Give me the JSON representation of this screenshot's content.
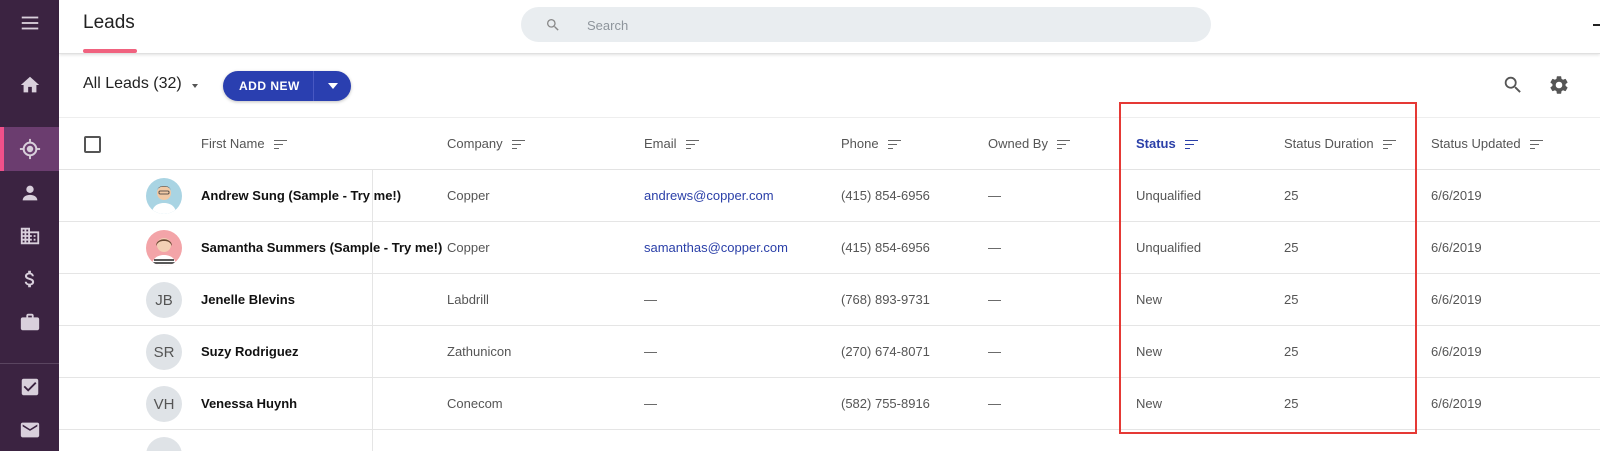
{
  "header": {
    "title": "Leads",
    "search_placeholder": "Search"
  },
  "sidebar": {
    "items": [
      {
        "icon": "menu-icon"
      },
      {
        "icon": "home-icon"
      },
      {
        "icon": "leads-target-icon",
        "active": true
      },
      {
        "icon": "person-icon"
      },
      {
        "icon": "company-building-icon"
      },
      {
        "icon": "dollar-icon"
      },
      {
        "icon": "briefcase-icon"
      },
      {
        "icon": "task-check-icon"
      },
      {
        "icon": "mail-icon"
      }
    ]
  },
  "toolbar": {
    "view_label": "All Leads (32)",
    "add_new_label": "ADD NEW"
  },
  "table": {
    "columns": [
      "First Name",
      "Company",
      "Email",
      "Phone",
      "Owned By",
      "Status",
      "Status Duration",
      "Status Updated"
    ],
    "sorted_column": "Status",
    "rows": [
      {
        "avatar": "",
        "avatar_type": "photo1",
        "name": "Andrew Sung (Sample - Try me!)",
        "company": "Copper",
        "email": "andrews@copper.com",
        "phone": "(415) 854-6956",
        "owned_by": "—",
        "status": "Unqualified",
        "duration": "25",
        "updated": "6/6/2019"
      },
      {
        "avatar": "",
        "avatar_type": "photo2",
        "name": "Samantha Summers (Sample - Try me!)",
        "company": "Copper",
        "email": "samanthas@copper.com",
        "phone": "(415) 854-6956",
        "owned_by": "—",
        "status": "Unqualified",
        "duration": "25",
        "updated": "6/6/2019"
      },
      {
        "avatar": "JB",
        "avatar_type": "initials",
        "name": "Jenelle Blevins",
        "company": "Labdrill",
        "email": "—",
        "phone": "(768) 893-9731",
        "owned_by": "—",
        "status": "New",
        "duration": "25",
        "updated": "6/6/2019"
      },
      {
        "avatar": "SR",
        "avatar_type": "initials",
        "name": "Suzy Rodriguez",
        "company": "Zathunicon",
        "email": "—",
        "phone": "(270) 674-8071",
        "owned_by": "—",
        "status": "New",
        "duration": "25",
        "updated": "6/6/2019"
      },
      {
        "avatar": "VH",
        "avatar_type": "initials",
        "name": "Venessa Huynh",
        "company": "Conecom",
        "email": "—",
        "phone": "(582) 755-8916",
        "owned_by": "—",
        "status": "New",
        "duration": "25",
        "updated": "6/6/2019"
      }
    ]
  },
  "colors": {
    "sidebar_bg": "#3b2341",
    "accent_blue": "#2a3fb0",
    "accent_pink": "#f0627f",
    "highlight_red": "#e53935"
  }
}
